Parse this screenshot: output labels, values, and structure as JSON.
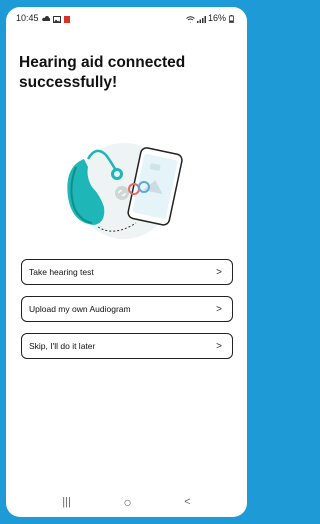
{
  "status_bar": {
    "time": "10:45",
    "battery": "16%"
  },
  "title": "Hearing aid connected successfully!",
  "options": [
    {
      "label": "Take hearing test",
      "chevron": ">"
    },
    {
      "label": "Upload my own Audiogram",
      "chevron": ">"
    },
    {
      "label": "Skip, I'll do it later",
      "chevron": ">"
    }
  ],
  "nav": {
    "recents": "|||",
    "home": "○",
    "back": "<"
  },
  "colors": {
    "background": "#1e9bd7",
    "teal": "#1eb6b6",
    "text": "#111111"
  }
}
